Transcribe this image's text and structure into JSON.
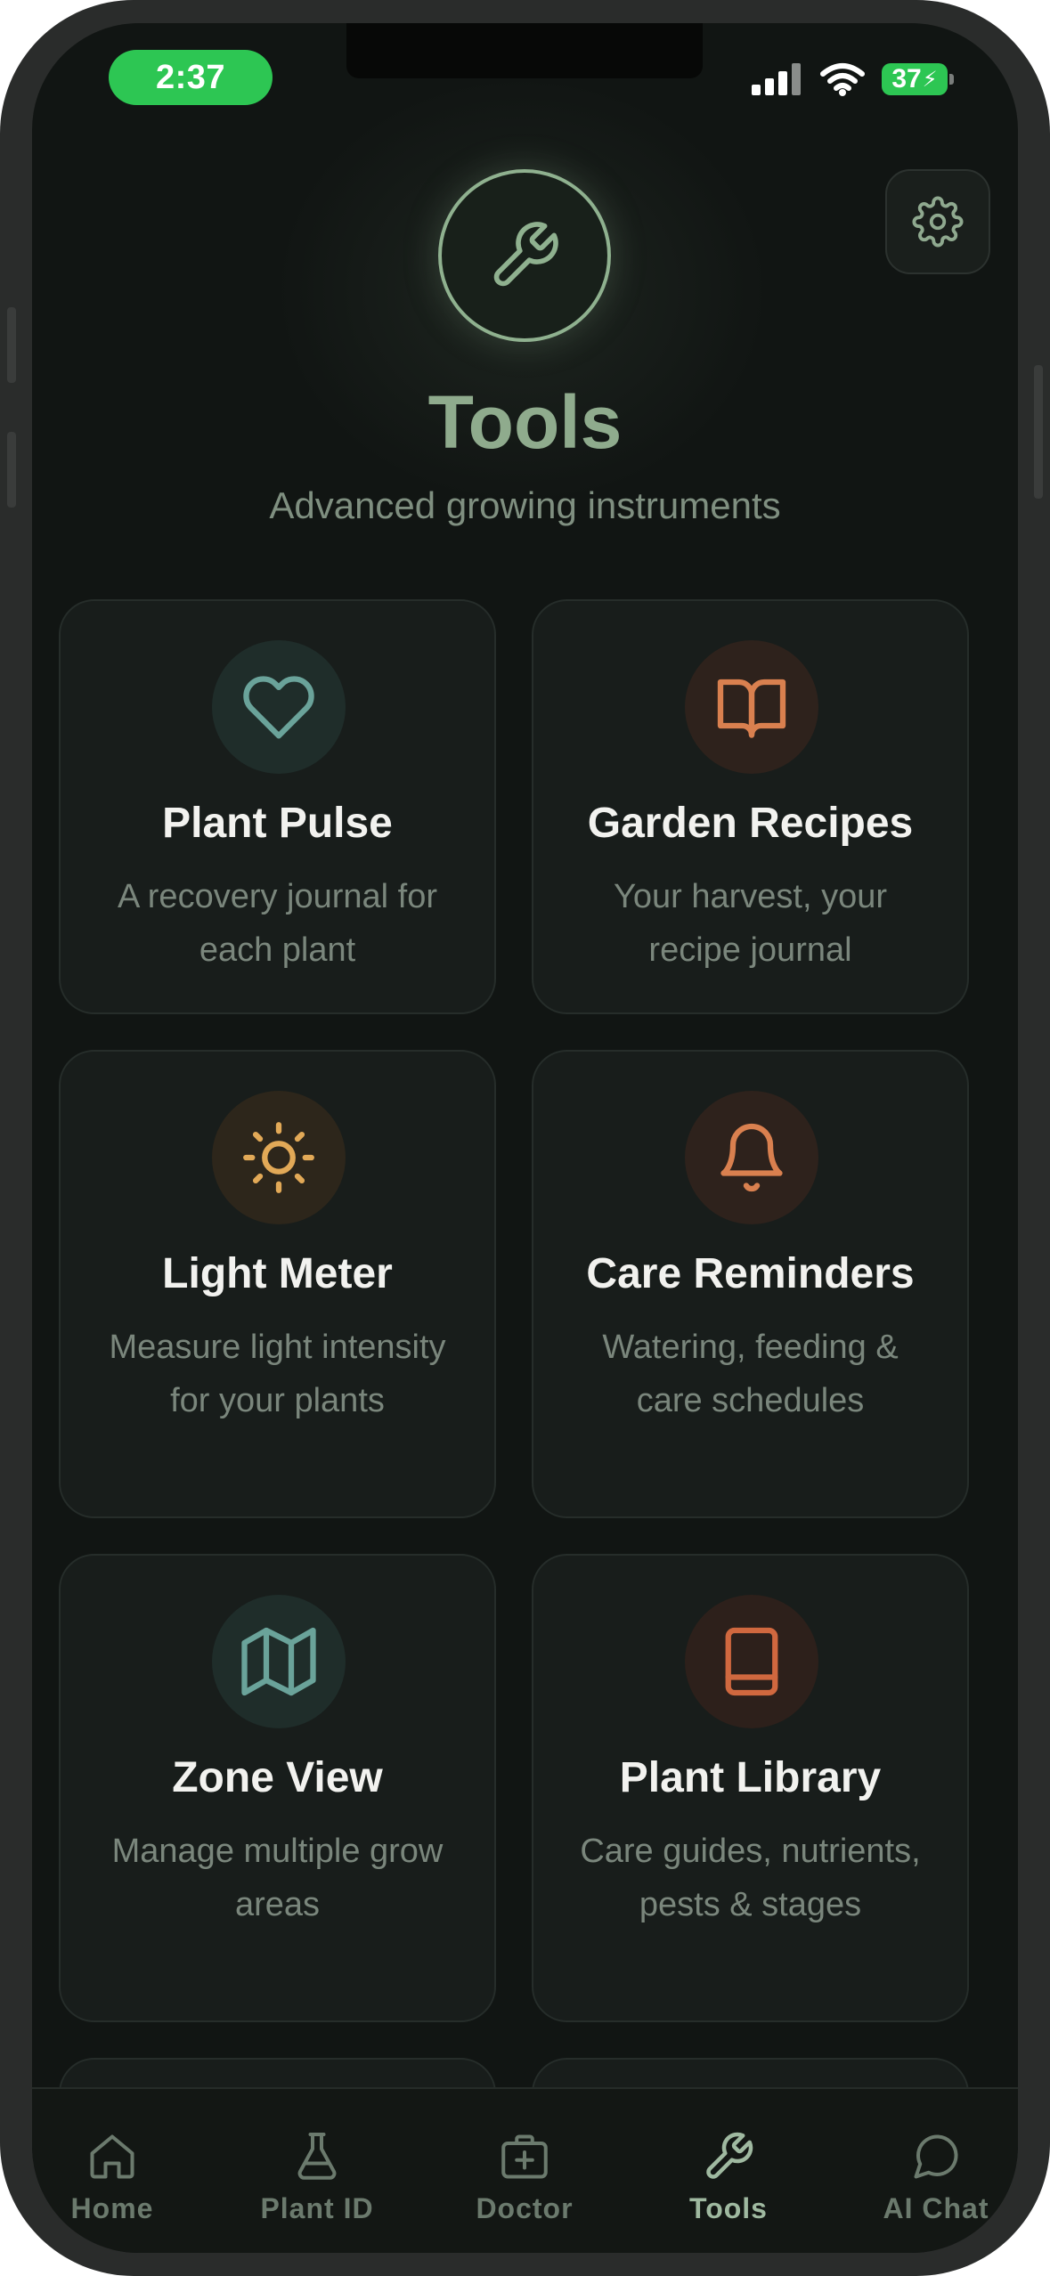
{
  "status_bar": {
    "time": "2:37",
    "battery": "37"
  },
  "header": {
    "title": "Tools",
    "subtitle": "Advanced growing instruments",
    "hero_icon": "wrench-icon",
    "settings_icon": "gear-icon"
  },
  "tools": [
    {
      "title": "Plant Pulse",
      "description": "A recovery journal for each plant",
      "icon": "heart-icon",
      "color": "#6aa39a"
    },
    {
      "title": "Garden Recipes",
      "description": "Your harvest, your recipe journal",
      "icon": "open-book-icon",
      "color": "#d9804f"
    },
    {
      "title": "Light Meter",
      "description": "Measure light intensity for your plants",
      "icon": "sun-icon",
      "color": "#e2a957"
    },
    {
      "title": "Care Reminders",
      "description": "Watering, feeding & care schedules",
      "icon": "bell-icon",
      "color": "#d9804f"
    },
    {
      "title": "Zone View",
      "description": "Manage multiple grow areas",
      "icon": "map-icon",
      "color": "#6aa39a"
    },
    {
      "title": "Plant Library",
      "description": "Care guides, nutrients, pests & stages",
      "icon": "book-icon",
      "color": "#d0683f"
    }
  ],
  "tabbar": {
    "active": "Tools",
    "items": [
      {
        "label": "Home",
        "icon": "home-icon"
      },
      {
        "label": "Plant ID",
        "icon": "flask-icon"
      },
      {
        "label": "Doctor",
        "icon": "medical-kit-icon"
      },
      {
        "label": "Tools",
        "icon": "wrench-icon"
      },
      {
        "label": "AI Chat",
        "icon": "chat-bubble-icon"
      }
    ]
  }
}
